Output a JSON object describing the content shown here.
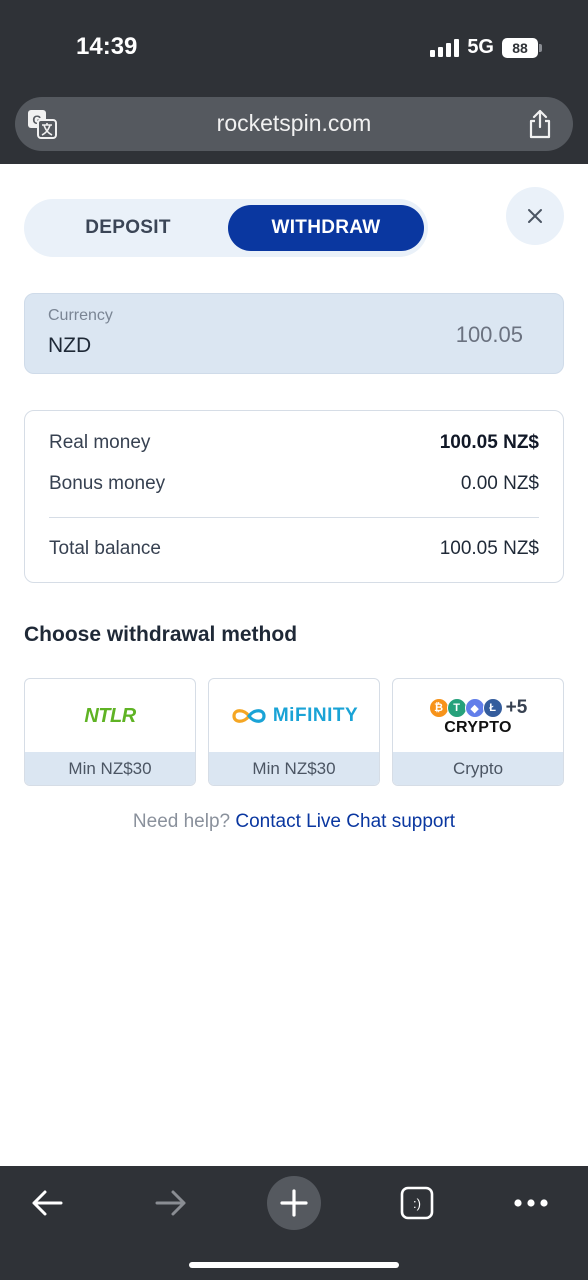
{
  "status_bar": {
    "time": "14:39",
    "network": "5G",
    "battery": "88"
  },
  "browser": {
    "url": "rocketspin.com"
  },
  "tabs": {
    "deposit": "DEPOSIT",
    "withdraw": "WITHDRAW",
    "active": "withdraw"
  },
  "currency": {
    "label": "Currency",
    "code": "NZD",
    "amount": "100.05"
  },
  "balance": {
    "rows": [
      {
        "label": "Real money",
        "value": "100.05 NZ$"
      },
      {
        "label": "Bonus money",
        "value": "0.00 NZ$"
      },
      {
        "label": "Total balance",
        "value": "100.05 NZ$"
      }
    ]
  },
  "withdrawal": {
    "title": "Choose withdrawal method",
    "methods": [
      {
        "logo_text": "NTLR",
        "caption": "Min NZ$30"
      },
      {
        "logo_text": "MiFINITY",
        "caption": "Min NZ$30"
      },
      {
        "logo_text": "CRYPTO",
        "extra": "+5",
        "caption": "Crypto"
      }
    ]
  },
  "help": {
    "prefix": "Need help?",
    "link": "Contact Live Chat support"
  },
  "colors": {
    "accent": "#0a37a0",
    "chrome": "#2f3237",
    "panel": "#dbe6f2",
    "ntlr_green": "#5fb324",
    "mifinity_blue": "#1aa3d6"
  },
  "icons": [
    "translate-icon",
    "share-icon",
    "close-icon",
    "back-arrow-icon",
    "forward-arrow-icon",
    "plus-icon",
    "tabs-icon",
    "more-icon"
  ]
}
